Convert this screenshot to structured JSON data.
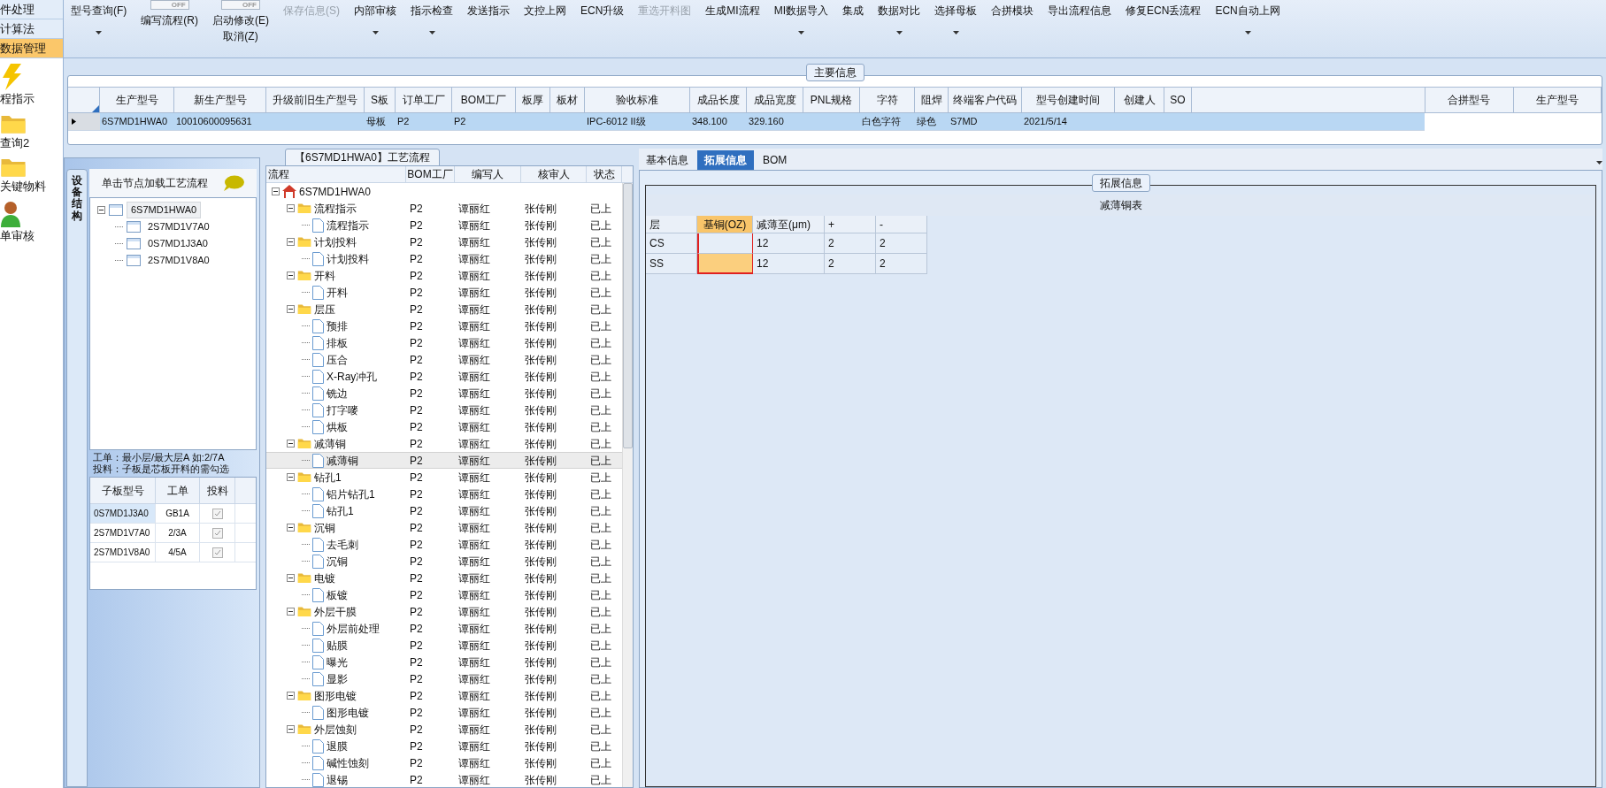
{
  "nav": [
    {
      "label": "件处理",
      "selected": false
    },
    {
      "label": "计算法",
      "selected": false
    },
    {
      "label": "数据管理",
      "selected": true
    }
  ],
  "nav_icons": [
    {
      "label": "程指示",
      "kind": "bolt"
    },
    {
      "label": "查询2",
      "kind": "folder"
    },
    {
      "label": "关键物料",
      "kind": "folder"
    },
    {
      "label": "单审核",
      "kind": "person"
    }
  ],
  "toolbar": [
    {
      "label": "型号查询(F)",
      "dropdown": true,
      "disabled": false
    },
    {
      "label": "编写流程(R)",
      "toggle": "OFF",
      "on": false,
      "dropdown": false,
      "disabled": false
    },
    {
      "label": "启动修改(E)",
      "toggle": "OFF",
      "on": false,
      "sub": "取消(Z)",
      "dropdown": false,
      "disabled": false
    },
    {
      "label": "保存信息(S)",
      "dropdown": false,
      "disabled": true
    },
    {
      "label": "内部审核",
      "dropdown": true,
      "disabled": false
    },
    {
      "label": "指示检查",
      "dropdown": true,
      "disabled": false
    },
    {
      "label": "发送指示",
      "dropdown": false,
      "disabled": false
    },
    {
      "label": "文控上网",
      "dropdown": false,
      "disabled": false
    },
    {
      "label": "ECN升级",
      "dropdown": false,
      "disabled": false
    },
    {
      "label": "重选开料图",
      "dropdown": false,
      "disabled": true
    },
    {
      "label": "生成MI流程",
      "dropdown": false,
      "disabled": false
    },
    {
      "label": "MI数据导入",
      "dropdown": true,
      "disabled": false
    },
    {
      "label": "集成",
      "dropdown": false,
      "disabled": false
    },
    {
      "label": "数据对比",
      "dropdown": true,
      "disabled": false
    },
    {
      "label": "选择母板",
      "dropdown": true,
      "disabled": false
    },
    {
      "label": "合拼模块",
      "dropdown": false,
      "disabled": false
    },
    {
      "label": "导出流程信息",
      "dropdown": false,
      "disabled": false
    },
    {
      "label": "修复ECN丢流程",
      "dropdown": false,
      "disabled": false
    },
    {
      "label": "ECN自动上网",
      "dropdown": true,
      "disabled": false
    }
  ],
  "main_info": {
    "title": "主要信息",
    "columns": [
      "生产型号",
      "新生产型号",
      "升级前旧生产型号",
      "S板",
      "订单工厂",
      "BOM工厂",
      "板厚",
      "板材",
      "验收标准",
      "成品长度",
      "成品宽度",
      "PNL规格",
      "字符",
      "阻焊",
      "终端客户代码",
      "型号创建时间",
      "创建人",
      "SO"
    ],
    "rows": [
      {
        "selected": true,
        "cells": [
          "6S7MD1HWA0",
          "10010600095631",
          "",
          "母板",
          "P2",
          "P2",
          "",
          "",
          "IPC-6012 II级",
          "348.100",
          "329.160",
          "",
          "白色字符",
          "绿色",
          "S7MD",
          "2021/5/14",
          "",
          ""
        ]
      }
    ],
    "side_columns": [
      "合拼型号",
      "生产型号"
    ]
  },
  "structure": {
    "tab": "设备结构",
    "hint": "单击节点加载工艺流程",
    "tree": [
      {
        "name": "6S7MD1HWA0",
        "selected": true,
        "expanded": true,
        "children": [
          {
            "name": "2S7MD1V7A0",
            "selected": false
          },
          {
            "name": "0S7MD1J3A0",
            "selected": false
          },
          {
            "name": "2S7MD1V8A0",
            "selected": false
          }
        ]
      }
    ],
    "notes": [
      "工单：最小层/最大层A 如:2/7A",
      "投料：子板是芯板开料的需勾选"
    ],
    "grid_columns": [
      "子板型号",
      "工单",
      "投料"
    ],
    "grid_rows": [
      {
        "model": "0S7MD1J3A0",
        "order": "GB1A",
        "checked": true,
        "selected": true
      },
      {
        "model": "2S7MD1V7A0",
        "order": "2/3A",
        "checked": true,
        "selected": false
      },
      {
        "model": "2S7MD1V8A0",
        "order": "4/5A",
        "checked": true,
        "selected": false
      }
    ]
  },
  "process": {
    "title": "【6S7MD1HWA0】工艺流程",
    "columns": [
      "流程",
      "BOM工厂",
      "编写人",
      "核审人",
      "状态"
    ],
    "tree": [
      {
        "kind": "root",
        "name": "6S7MD1HWA0",
        "expanded": true,
        "selected": false,
        "children": [
          {
            "kind": "folder",
            "name": "流程指示",
            "bom": "P2",
            "writer": "谭丽红",
            "reviewer": "张传刚",
            "status": "已上",
            "expanded": true,
            "selected": false,
            "children": [
              {
                "kind": "page",
                "name": "流程指示",
                "bom": "P2",
                "writer": "谭丽红",
                "reviewer": "张传刚",
                "status": "已上",
                "selected": false
              }
            ]
          },
          {
            "kind": "folder",
            "name": "计划投料",
            "bom": "P2",
            "writer": "谭丽红",
            "reviewer": "张传刚",
            "status": "已上",
            "expanded": true,
            "selected": false,
            "children": [
              {
                "kind": "page",
                "name": "计划投料",
                "bom": "P2",
                "writer": "谭丽红",
                "reviewer": "张传刚",
                "status": "已上",
                "selected": false
              }
            ]
          },
          {
            "kind": "folder",
            "name": "开料",
            "bom": "P2",
            "writer": "谭丽红",
            "reviewer": "张传刚",
            "status": "已上",
            "expanded": true,
            "selected": false,
            "children": [
              {
                "kind": "page",
                "name": "开料",
                "bom": "P2",
                "writer": "谭丽红",
                "reviewer": "张传刚",
                "status": "已上",
                "selected": false
              }
            ]
          },
          {
            "kind": "folder",
            "name": "层压",
            "bom": "P2",
            "writer": "谭丽红",
            "reviewer": "张传刚",
            "status": "已上",
            "expanded": true,
            "selected": false,
            "children": [
              {
                "kind": "page",
                "name": "预排",
                "bom": "P2",
                "writer": "谭丽红",
                "reviewer": "张传刚",
                "status": "已上",
                "selected": false
              },
              {
                "kind": "page",
                "name": "排板",
                "bom": "P2",
                "writer": "谭丽红",
                "reviewer": "张传刚",
                "status": "已上",
                "selected": false
              },
              {
                "kind": "page",
                "name": "压合",
                "bom": "P2",
                "writer": "谭丽红",
                "reviewer": "张传刚",
                "status": "已上",
                "selected": false
              },
              {
                "kind": "page",
                "name": "X-Ray冲孔",
                "bom": "P2",
                "writer": "谭丽红",
                "reviewer": "张传刚",
                "status": "已上",
                "selected": false
              },
              {
                "kind": "page",
                "name": "铣边",
                "bom": "P2",
                "writer": "谭丽红",
                "reviewer": "张传刚",
                "status": "已上",
                "selected": false
              },
              {
                "kind": "page",
                "name": "打字嘜",
                "bom": "P2",
                "writer": "谭丽红",
                "reviewer": "张传刚",
                "status": "已上",
                "selected": false
              },
              {
                "kind": "page",
                "name": "烘板",
                "bom": "P2",
                "writer": "谭丽红",
                "reviewer": "张传刚",
                "status": "已上",
                "selected": false
              }
            ]
          },
          {
            "kind": "folder",
            "name": "减薄铜",
            "bom": "P2",
            "writer": "谭丽红",
            "reviewer": "张传刚",
            "status": "已上",
            "expanded": true,
            "selected": false,
            "children": [
              {
                "kind": "page",
                "name": "减薄铜",
                "bom": "P2",
                "writer": "谭丽红",
                "reviewer": "张传刚",
                "status": "已上",
                "selected": true
              }
            ]
          },
          {
            "kind": "folder",
            "name": "钻孔1",
            "bom": "P2",
            "writer": "谭丽红",
            "reviewer": "张传刚",
            "status": "已上",
            "expanded": true,
            "selected": false,
            "children": [
              {
                "kind": "page",
                "name": "铝片钻孔1",
                "bom": "P2",
                "writer": "谭丽红",
                "reviewer": "张传刚",
                "status": "已上",
                "selected": false
              },
              {
                "kind": "page",
                "name": "钻孔1",
                "bom": "P2",
                "writer": "谭丽红",
                "reviewer": "张传刚",
                "status": "已上",
                "selected": false
              }
            ]
          },
          {
            "kind": "folder",
            "name": "沉铜",
            "bom": "P2",
            "writer": "谭丽红",
            "reviewer": "张传刚",
            "status": "已上",
            "expanded": true,
            "selected": false,
            "children": [
              {
                "kind": "page",
                "name": "去毛刺",
                "bom": "P2",
                "writer": "谭丽红",
                "reviewer": "张传刚",
                "status": "已上",
                "selected": false
              },
              {
                "kind": "page",
                "name": "沉铜",
                "bom": "P2",
                "writer": "谭丽红",
                "reviewer": "张传刚",
                "status": "已上",
                "selected": false
              }
            ]
          },
          {
            "kind": "folder",
            "name": "电镀",
            "bom": "P2",
            "writer": "谭丽红",
            "reviewer": "张传刚",
            "status": "已上",
            "expanded": true,
            "selected": false,
            "children": [
              {
                "kind": "page",
                "name": "板镀",
                "bom": "P2",
                "writer": "谭丽红",
                "reviewer": "张传刚",
                "status": "已上",
                "selected": false
              }
            ]
          },
          {
            "kind": "folder",
            "name": "外层干膜",
            "bom": "P2",
            "writer": "谭丽红",
            "reviewer": "张传刚",
            "status": "已上",
            "expanded": true,
            "selected": false,
            "children": [
              {
                "kind": "page",
                "name": "外层前处理",
                "bom": "P2",
                "writer": "谭丽红",
                "reviewer": "张传刚",
                "status": "已上",
                "selected": false
              },
              {
                "kind": "page",
                "name": "贴膜",
                "bom": "P2",
                "writer": "谭丽红",
                "reviewer": "张传刚",
                "status": "已上",
                "selected": false
              },
              {
                "kind": "page",
                "name": "曝光",
                "bom": "P2",
                "writer": "谭丽红",
                "reviewer": "张传刚",
                "status": "已上",
                "selected": false
              },
              {
                "kind": "page",
                "name": "显影",
                "bom": "P2",
                "writer": "谭丽红",
                "reviewer": "张传刚",
                "status": "已上",
                "selected": false
              }
            ]
          },
          {
            "kind": "folder",
            "name": "图形电镀",
            "bom": "P2",
            "writer": "谭丽红",
            "reviewer": "张传刚",
            "status": "已上",
            "expanded": true,
            "selected": false,
            "children": [
              {
                "kind": "page",
                "name": "图形电镀",
                "bom": "P2",
                "writer": "谭丽红",
                "reviewer": "张传刚",
                "status": "已上",
                "selected": false
              }
            ]
          },
          {
            "kind": "folder",
            "name": "外层蚀刻",
            "bom": "P2",
            "writer": "谭丽红",
            "reviewer": "张传刚",
            "status": "已上",
            "expanded": true,
            "selected": false,
            "children": [
              {
                "kind": "page",
                "name": "退膜",
                "bom": "P2",
                "writer": "谭丽红",
                "reviewer": "张传刚",
                "status": "已上",
                "selected": false
              },
              {
                "kind": "page",
                "name": "碱性蚀刻",
                "bom": "P2",
                "writer": "谭丽红",
                "reviewer": "张传刚",
                "status": "已上",
                "selected": false
              },
              {
                "kind": "page",
                "name": "退锡",
                "bom": "P2",
                "writer": "谭丽红",
                "reviewer": "张传刚",
                "status": "已上",
                "selected": false
              }
            ]
          }
        ]
      }
    ]
  },
  "detail": {
    "tabs": [
      {
        "label": "基本信息",
        "selected": false
      },
      {
        "label": "拓展信息",
        "selected": true
      },
      {
        "label": "BOM",
        "selected": false
      }
    ],
    "group": "拓展信息",
    "table_title": "减薄铜表",
    "columns": [
      {
        "label": "层",
        "outlined": false
      },
      {
        "label": "基铜(OZ)",
        "outlined": true
      },
      {
        "label": "减薄至(μm)",
        "outlined": false
      },
      {
        "label": "+",
        "outlined": false
      },
      {
        "label": "-",
        "outlined": false
      }
    ],
    "rows": [
      {
        "cells": [
          {
            "text": "CS",
            "selected": false
          },
          {
            "text": "",
            "selected": false
          },
          {
            "text": "12",
            "selected": false
          },
          {
            "text": "2",
            "selected": false
          },
          {
            "text": "2",
            "selected": false
          }
        ]
      },
      {
        "cells": [
          {
            "text": "SS",
            "selected": false
          },
          {
            "text": "",
            "selected": true
          },
          {
            "text": "12",
            "selected": false
          },
          {
            "text": "2",
            "selected": false
          },
          {
            "text": "2",
            "selected": false
          }
        ]
      }
    ]
  }
}
